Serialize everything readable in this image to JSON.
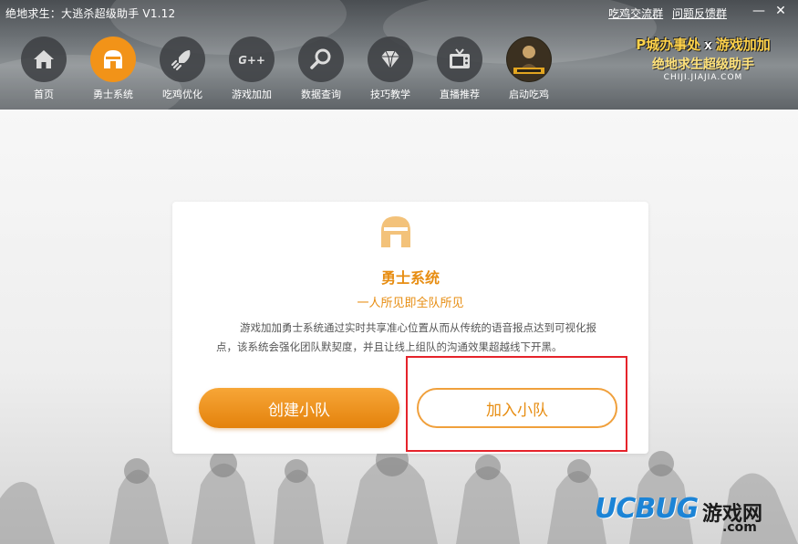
{
  "window": {
    "title": "绝地求生：大逃杀超级助手 V1.12",
    "links": [
      "吃鸡交流群",
      "问题反馈群"
    ],
    "min_symbol": "—",
    "close_symbol": "✕"
  },
  "nav": [
    {
      "label": "首页",
      "icon": "home-icon",
      "active": false
    },
    {
      "label": "勇士系统",
      "icon": "helmet-icon",
      "active": true
    },
    {
      "label": "吃鸡优化",
      "icon": "rocket-icon",
      "active": false
    },
    {
      "label": "游戏加加",
      "icon": "gplus-icon",
      "active": false
    },
    {
      "label": "数据查询",
      "icon": "magnifier-icon",
      "active": false
    },
    {
      "label": "技巧教学",
      "icon": "diamond-icon",
      "active": false
    },
    {
      "label": "直播推荐",
      "icon": "tv-icon",
      "active": false
    },
    {
      "label": "启动吃鸡",
      "icon": "pubg-logo-icon",
      "active": false
    }
  ],
  "brand": {
    "line1_left": "P城办事处",
    "line1_x": "X",
    "line1_right": "游戏加加",
    "line2": "绝地求生超级助手",
    "line3": "CHIJI.JIAJIA.COM"
  },
  "card": {
    "title": "勇士系统",
    "subtitle": "一人所见即全队所见",
    "description": "游戏加加勇士系统通过实时共享准心位置从而从传统的语音报点达到可视化报点，该系统会强化团队默契度，并且让线上组队的沟通效果超越线下开黑。",
    "create_button": "创建小队",
    "join_button": "加入小队"
  },
  "watermark": {
    "brand": "UCBUG",
    "cn": "游戏网",
    "domain": ".com"
  },
  "colors": {
    "accent": "#e78d12",
    "highlight_box": "#e5232b",
    "watermark_blue": "#1c84d6"
  }
}
